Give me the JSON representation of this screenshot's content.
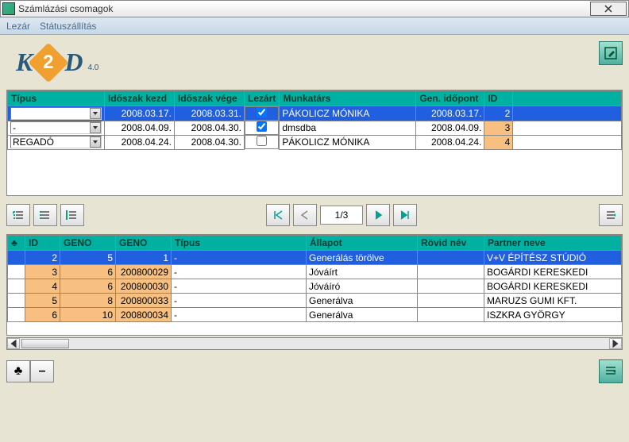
{
  "window": {
    "title": "Számlázási csomagok"
  },
  "menu": {
    "lezar": "Lezár",
    "statusz": "Státuszállítás"
  },
  "logo": {
    "k": "K",
    "d": "D",
    "two": "2",
    "ver": "4.0"
  },
  "grid1": {
    "headers": {
      "tipus": "Típus",
      "idokezd": "Időszak kezd",
      "idovege": "Időszak vége",
      "lezar": "Lezárt",
      "munkatars": "Munkatárs",
      "genido": "Gen. időpont",
      "id": "ID"
    },
    "rows": [
      {
        "tipus": "-",
        "kezd": "2008.03.17.",
        "vege": "2008.03.31.",
        "lezart": true,
        "munkatars": "PÁKOLICZ MÓNIKA",
        "gen": "2008.03.17.",
        "id": "2",
        "sel": true
      },
      {
        "tipus": "-",
        "kezd": "2008.04.09.",
        "vege": "2008.04.30.",
        "lezart": true,
        "munkatars": "dmsdba",
        "gen": "2008.04.09.",
        "id": "3",
        "sel": false
      },
      {
        "tipus": "REGADÓ",
        "kezd": "2008.04.24.",
        "vege": "2008.04.30.",
        "lezart": false,
        "munkatars": "PÁKOLICZ MÓNIKA",
        "gen": "2008.04.24.",
        "id": "4",
        "sel": false
      }
    ]
  },
  "pager": {
    "text": "1/3"
  },
  "grid2": {
    "headers": {
      "corner": "♣",
      "id": "ID",
      "geno1": "GENO",
      "geno2": "GENO",
      "tipus": "Típus",
      "allapot": "Állapot",
      "rovid": "Rövid név",
      "partner": "Partner neve"
    },
    "rows": [
      {
        "id": "2",
        "g1": "5",
        "g2": "1",
        "tipus": "-",
        "allapot": "Generálás törölve",
        "rovid": "",
        "partner": "V+V ÉPÍTÉSZ STÚDIÓ",
        "sel": true
      },
      {
        "id": "3",
        "g1": "6",
        "g2": "200800029",
        "tipus": "-",
        "allapot": "Jóváírt",
        "rovid": "",
        "partner": "BOGÁRDI KERESKEDI",
        "sel": false
      },
      {
        "id": "4",
        "g1": "6",
        "g2": "200800030",
        "tipus": "-",
        "allapot": "Jóváíró",
        "rovid": "",
        "partner": "BOGÁRDI KERESKEDI",
        "sel": false
      },
      {
        "id": "5",
        "g1": "8",
        "g2": "200800033",
        "tipus": "-",
        "allapot": "Generálva",
        "rovid": "",
        "partner": "MARUZS GUMI KFT.",
        "sel": false
      },
      {
        "id": "6",
        "g1": "10",
        "g2": "200800034",
        "tipus": "-",
        "allapot": "Generálva",
        "rovid": "",
        "partner": "ISZKRA GYÖRGY",
        "sel": false
      }
    ]
  },
  "bottom": {
    "club": "♣",
    "minus": "–"
  }
}
